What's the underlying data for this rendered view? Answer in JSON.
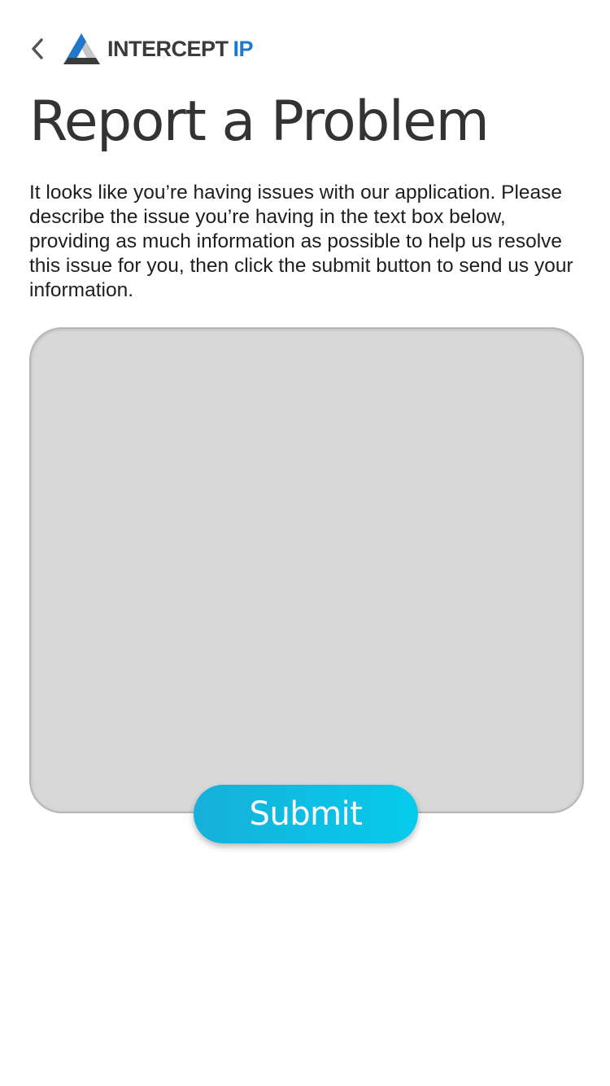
{
  "header": {
    "back_icon": "chevron-left-icon",
    "logo": {
      "icon": "triangle-logo-icon",
      "text_main": "INTERCEPT",
      "text_accent": "IP",
      "colors": {
        "dark": "#3a3a3a",
        "accent": "#1f78c8",
        "light": "#c6c6c6"
      }
    }
  },
  "page": {
    "title": "Report a Problem",
    "description": "It looks like you’re having issues with our application. Please describe the issue you’re having in the text box below, providing as much information as possible to help us resolve this issue for you, then click the submit button to send us your information."
  },
  "form": {
    "issue_value": "",
    "issue_placeholder": "",
    "submit_label": "Submit",
    "colors": {
      "textbox_bg": "#d8d8d8",
      "button_gradient_start": "#16b0da",
      "button_gradient_end": "#06cbec"
    }
  }
}
